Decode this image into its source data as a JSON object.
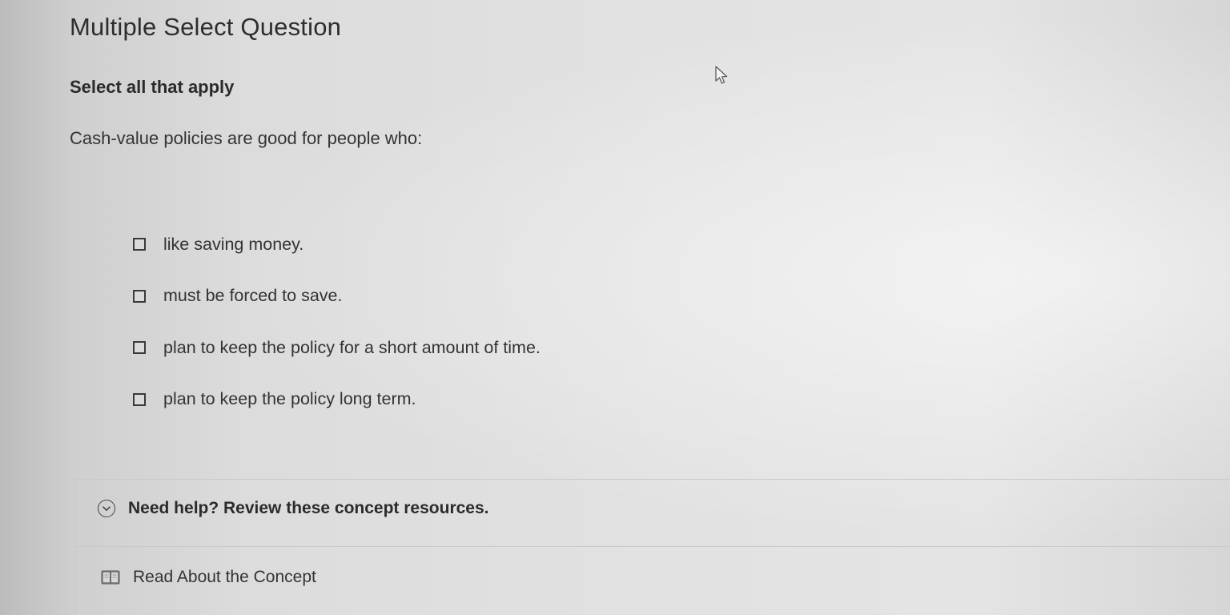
{
  "question": {
    "type_label": "Multiple Select Question",
    "instruction": "Select all that apply",
    "prompt": "Cash-value policies are good for people who:"
  },
  "options": [
    {
      "label": "like saving money.",
      "checked": false
    },
    {
      "label": "must be forced to save.",
      "checked": false
    },
    {
      "label": "plan to keep the policy for a short amount of time.",
      "checked": false
    },
    {
      "label": "plan to keep the policy long term.",
      "checked": false
    }
  ],
  "help": {
    "title": "Need help? Review these concept resources.",
    "expand_icon": "chevron-down-icon",
    "resources": [
      {
        "label": "Read About the Concept",
        "icon": "book-icon"
      }
    ]
  }
}
